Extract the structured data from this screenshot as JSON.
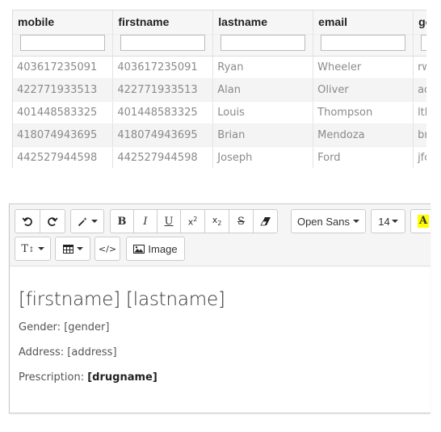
{
  "grid": {
    "columns": [
      "mobile",
      "firstname",
      "lastname",
      "email",
      "gender"
    ],
    "rows": [
      [
        "403617235091",
        "403617235091",
        "Ryan",
        "Wheeler",
        "rwheeler"
      ],
      [
        "422771933513",
        "422771933513",
        "Alan",
        "Oliver",
        "aoliver"
      ],
      [
        "401448583325",
        "401448583325",
        "Louis",
        "Thompson",
        "lthompson"
      ],
      [
        "418074943695",
        "418074943695",
        "Brian",
        "Mendoza",
        "bmendoza"
      ],
      [
        "442527944598",
        "442527944598",
        "Joseph",
        "Ford",
        "jford"
      ]
    ]
  },
  "toolbar": {
    "font_family": "Open Sans",
    "font_size": "14",
    "image_label": "Image",
    "highlight_letter": "A",
    "highlight_color": "#ffff00"
  },
  "editor": {
    "heading": "[firstname] [lastname]",
    "gender_label": "Gender:",
    "gender_value": "[gender]",
    "address_label": "Address:",
    "address_value": "[address]",
    "prescription_label": "Prescription:",
    "prescription_value": "[drugname]"
  }
}
